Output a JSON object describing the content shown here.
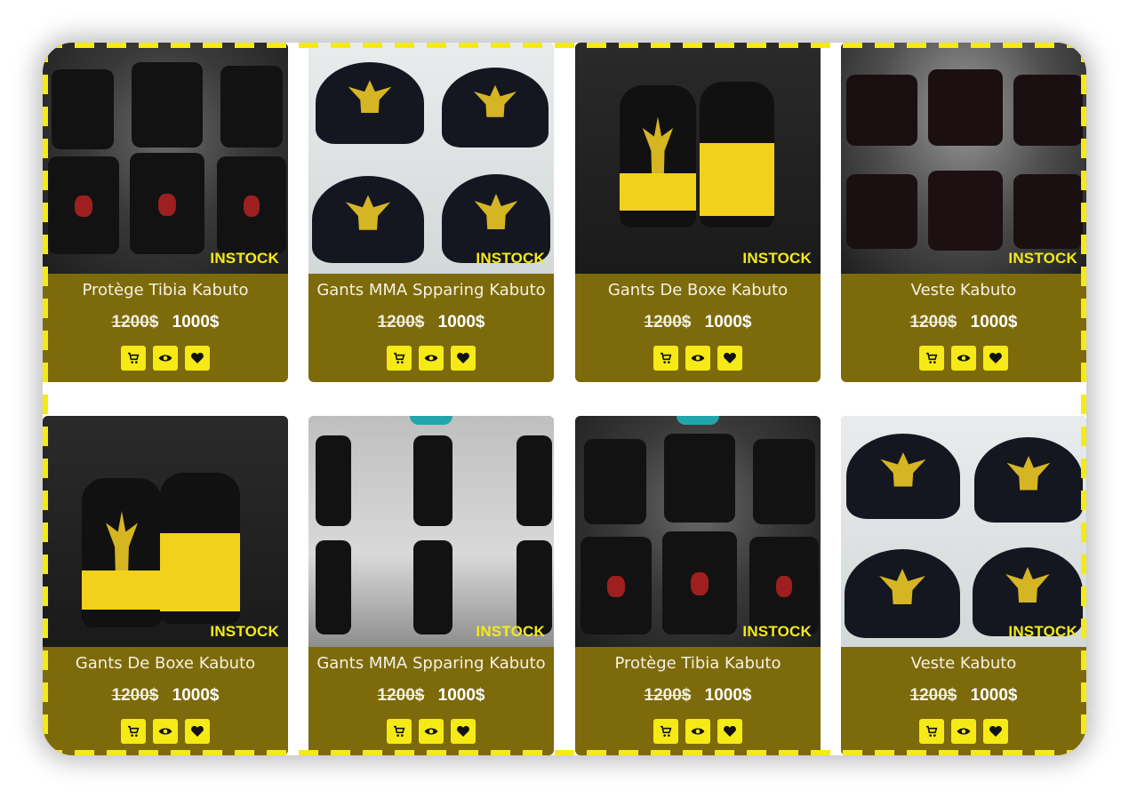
{
  "colors": {
    "accent": "#f5ea16",
    "card_bg": "#7d6a0a",
    "ribbon": "#22a6ad"
  },
  "products": [
    {
      "title": "Protège Tibia Kabuto",
      "old_price": "1200$",
      "price": "1000$",
      "stock": "INSTOCK"
    },
    {
      "title": "Gants MMA Spparing Kabuto",
      "old_price": "1200$",
      "price": "1000$",
      "stock": "INSTOCK"
    },
    {
      "title": "Gants De Boxe Kabuto",
      "old_price": "1200$",
      "price": "1000$",
      "stock": "INSTOCK"
    },
    {
      "title": "Veste Kabuto",
      "old_price": "1200$",
      "price": "1000$",
      "stock": "INSTOCK"
    },
    {
      "title": "Gants De Boxe Kabuto",
      "old_price": "1200$",
      "price": "1000$",
      "stock": "INSTOCK"
    },
    {
      "title": "Gants MMA Spparing Kabuto",
      "old_price": "1200$",
      "price": "1000$",
      "stock": "INSTOCK"
    },
    {
      "title": "Protège Tibia Kabuto",
      "old_price": "1200$",
      "price": "1000$",
      "stock": "INSTOCK"
    },
    {
      "title": "Veste Kabuto",
      "old_price": "1200$",
      "price": "1000$",
      "stock": "INSTOCK"
    }
  ],
  "actions": [
    "add-to-cart-icon",
    "eye-icon",
    "heart-icon"
  ]
}
